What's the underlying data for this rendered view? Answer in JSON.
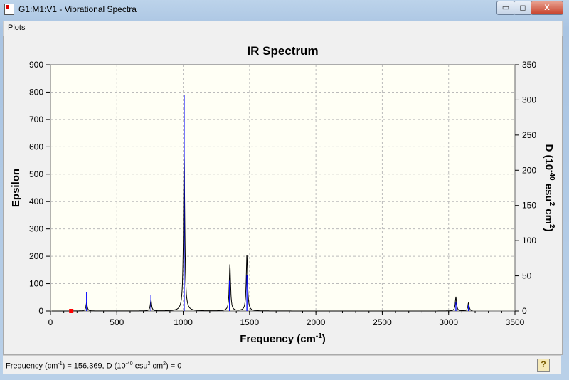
{
  "window": {
    "title": "G1:M1:V1 - Vibrational Spectra",
    "minimize": "▭",
    "maximize": "◻",
    "close": "X"
  },
  "menu": {
    "items": [
      "Plots"
    ]
  },
  "status": {
    "text_prefix": "Frequency (cm",
    "text_mid": ") = 156.369, D (10",
    "text_mid2": " esu",
    "text_mid3": " cm",
    "text_end": ") = 0",
    "sup1": "-1",
    "sup2": "-40",
    "sup3": "2",
    "sup4": "2"
  },
  "chart_data": {
    "type": "line",
    "title": "IR Spectrum",
    "xlabel": "Frequency (cm-1)",
    "ylabel": "Epsilon",
    "y2label": "D (10-40 esu2 cm2)",
    "xlim": [
      0,
      3500
    ],
    "ylim": [
      0,
      900
    ],
    "y2lim": [
      0,
      350
    ],
    "xticks": [
      0,
      500,
      1000,
      1500,
      2000,
      2500,
      3000,
      3500
    ],
    "yticks": [
      0,
      100,
      200,
      300,
      400,
      500,
      600,
      700,
      800,
      900
    ],
    "y2ticks": [
      0,
      50,
      100,
      150,
      200,
      250,
      300,
      350
    ],
    "grid": true,
    "colors": {
      "spectrum": "#000000",
      "sticks": "#0000ff",
      "marker": "#ff0000",
      "background": "#fffff5"
    },
    "spectrum_peaks": [
      {
        "x": 272,
        "y": 30
      },
      {
        "x": 757,
        "y": 40
      },
      {
        "x": 1007,
        "y": 570
      },
      {
        "x": 1352,
        "y": 170
      },
      {
        "x": 1480,
        "y": 205
      },
      {
        "x": 3055,
        "y": 50
      },
      {
        "x": 3150,
        "y": 30
      }
    ],
    "sticks_D": [
      {
        "x": 272,
        "y": 27
      },
      {
        "x": 757,
        "y": 23
      },
      {
        "x": 1007,
        "y": 307
      },
      {
        "x": 1349,
        "y": 43
      },
      {
        "x": 1480,
        "y": 51
      },
      {
        "x": 3055,
        "y": 12
      },
      {
        "x": 3150,
        "y": 8
      }
    ],
    "selected_point": {
      "x": 156.369,
      "y": 0
    }
  }
}
